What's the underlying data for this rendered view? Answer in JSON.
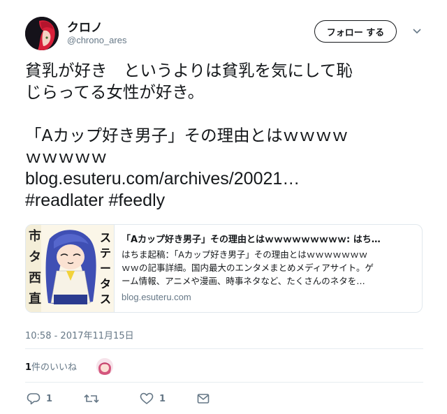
{
  "author": {
    "display_name": "クロノ",
    "handle": "@chrono_ares"
  },
  "follow_button_label": "フォロー する",
  "tweet": {
    "lines": [
      "貧乳が好き　というよりは貧乳を気にして恥",
      "じらってる女性が好き。",
      "「Aカップ好き男子」その理由とはｗｗｗｗ",
      "ｗｗｗｗｗ"
    ],
    "link": "blog.esuteru.com/archives/20021…",
    "hashtags": "#readlater #feedly"
  },
  "card": {
    "title": "「Aカップ好き男子」その理由とはｗｗｗｗｗｗｗｗｗ: はち…",
    "description_lines": [
      "はちま起稿：「Aカップ好き男子」その理由とはｗｗｗｗｗｗｗ",
      "ｗｗの記事詳細。国内最大のエンタメまとめメディアサイト。ゲ",
      "ーム情報、アニメや漫画、時事ネタなど、たくさんのネタを…"
    ],
    "domain": "blog.esuteru.com",
    "image_text": "ステータスだ"
  },
  "timestamp": "10:58 - 2017年11月15日",
  "likes": {
    "count": "1",
    "label": "件のいいね"
  },
  "actions": {
    "reply_count": "1",
    "retweet_count": "",
    "like_count": "1"
  },
  "colors": {
    "text": "#14171a",
    "secondary": "#657786",
    "border": "#e1e8ed"
  },
  "icons": [
    "reply-icon",
    "retweet-icon",
    "heart-icon",
    "mail-icon",
    "chevron-down-icon"
  ]
}
